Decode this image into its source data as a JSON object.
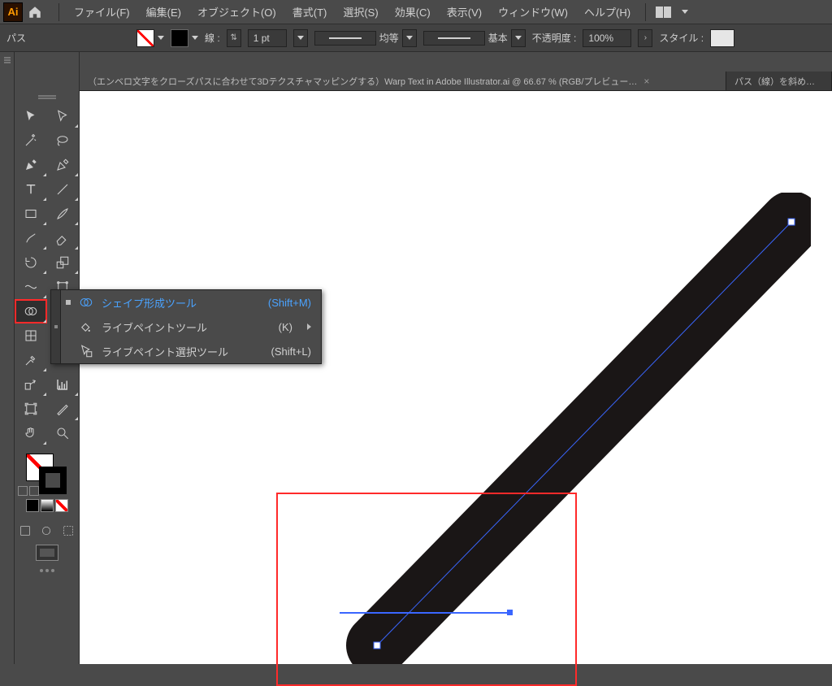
{
  "app": {
    "logo_text": "Ai"
  },
  "menus": {
    "file": "ファイル(F)",
    "edit": "編集(E)",
    "object": "オブジェクト(O)",
    "type": "書式(T)",
    "select": "選択(S)",
    "effect": "効果(C)",
    "view": "表示(V)",
    "window": "ウィンドウ(W)",
    "help": "ヘルプ(H)"
  },
  "controlbar": {
    "object_label": "パス",
    "stroke_label": "線 :",
    "stroke_weight": "1 pt",
    "profile_label": "均等",
    "brush_label": "基本",
    "opacity_label": "不透明度 :",
    "opacity_value": "100%",
    "style_label": "スタイル :"
  },
  "tabs": {
    "active": "（エンベロ文字をクローズパスに合わせて3Dテクスチャマッピングする）Warp Text in Adobe Illustrator.ai @ 66.67 % (RGB/プレビュー…",
    "close": "×",
    "second": "パス（線）を斜めに…"
  },
  "flyout": {
    "items": [
      {
        "name": "シェイプ形成ツール",
        "shortcut": "(Shift+M)",
        "selected": true,
        "submenu": false
      },
      {
        "name": "ライブペイントツール",
        "shortcut": "(K)",
        "selected": false,
        "submenu": true
      },
      {
        "name": "ライブペイント選択ツール",
        "shortcut": "(Shift+L)",
        "selected": false,
        "submenu": false
      }
    ]
  }
}
